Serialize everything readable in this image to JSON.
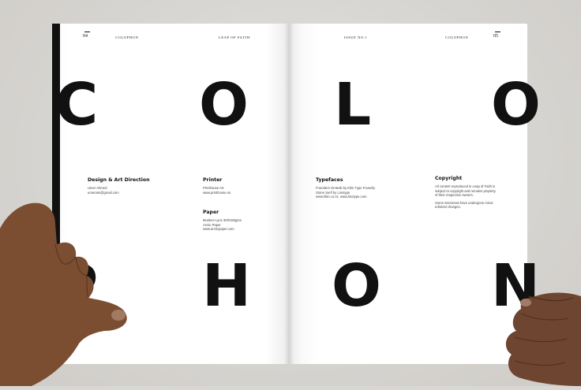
{
  "left_page": {
    "page_number": "04",
    "header_center": "COLOPHON",
    "header_right": "LEAP OF FAITH",
    "letters_top": [
      "C",
      "O"
    ],
    "letters_bottom": [
      "P",
      "H"
    ],
    "design": {
      "heading": "Design & Art Direction",
      "lines": [
        "Umer Ahmed",
        "umeraim@gmail.com"
      ]
    },
    "printer": {
      "heading": "Printer",
      "lines": [
        "Printhouse AS",
        "www.printhouse.no"
      ]
    },
    "paper": {
      "heading": "Paper",
      "lines": [
        "Munken Lynx 300/150gsm",
        "Arctic Paper",
        "www.arcticpaper.com"
      ]
    }
  },
  "right_page": {
    "page_number": "05",
    "header_left": "ISSUE NO.1",
    "header_right": "COLOPHON",
    "letters_top": [
      "L",
      "O"
    ],
    "letters_bottom": [
      "O",
      "N"
    ],
    "typefaces": {
      "heading": "Typefaces",
      "lines": [
        "Founders Grotesk by Klim Type Foundry",
        "Stone Serif by Linotype",
        "www.klim.co.nz, www.linotype.com"
      ]
    },
    "copyright": {
      "heading": "Copyright",
      "lines": [
        "All content reproduced in Leap of Faith is",
        "subject to copyright and remains property",
        "of their respective owners.",
        "",
        "Some interviews have undergone minor",
        "editorial changes."
      ]
    }
  }
}
